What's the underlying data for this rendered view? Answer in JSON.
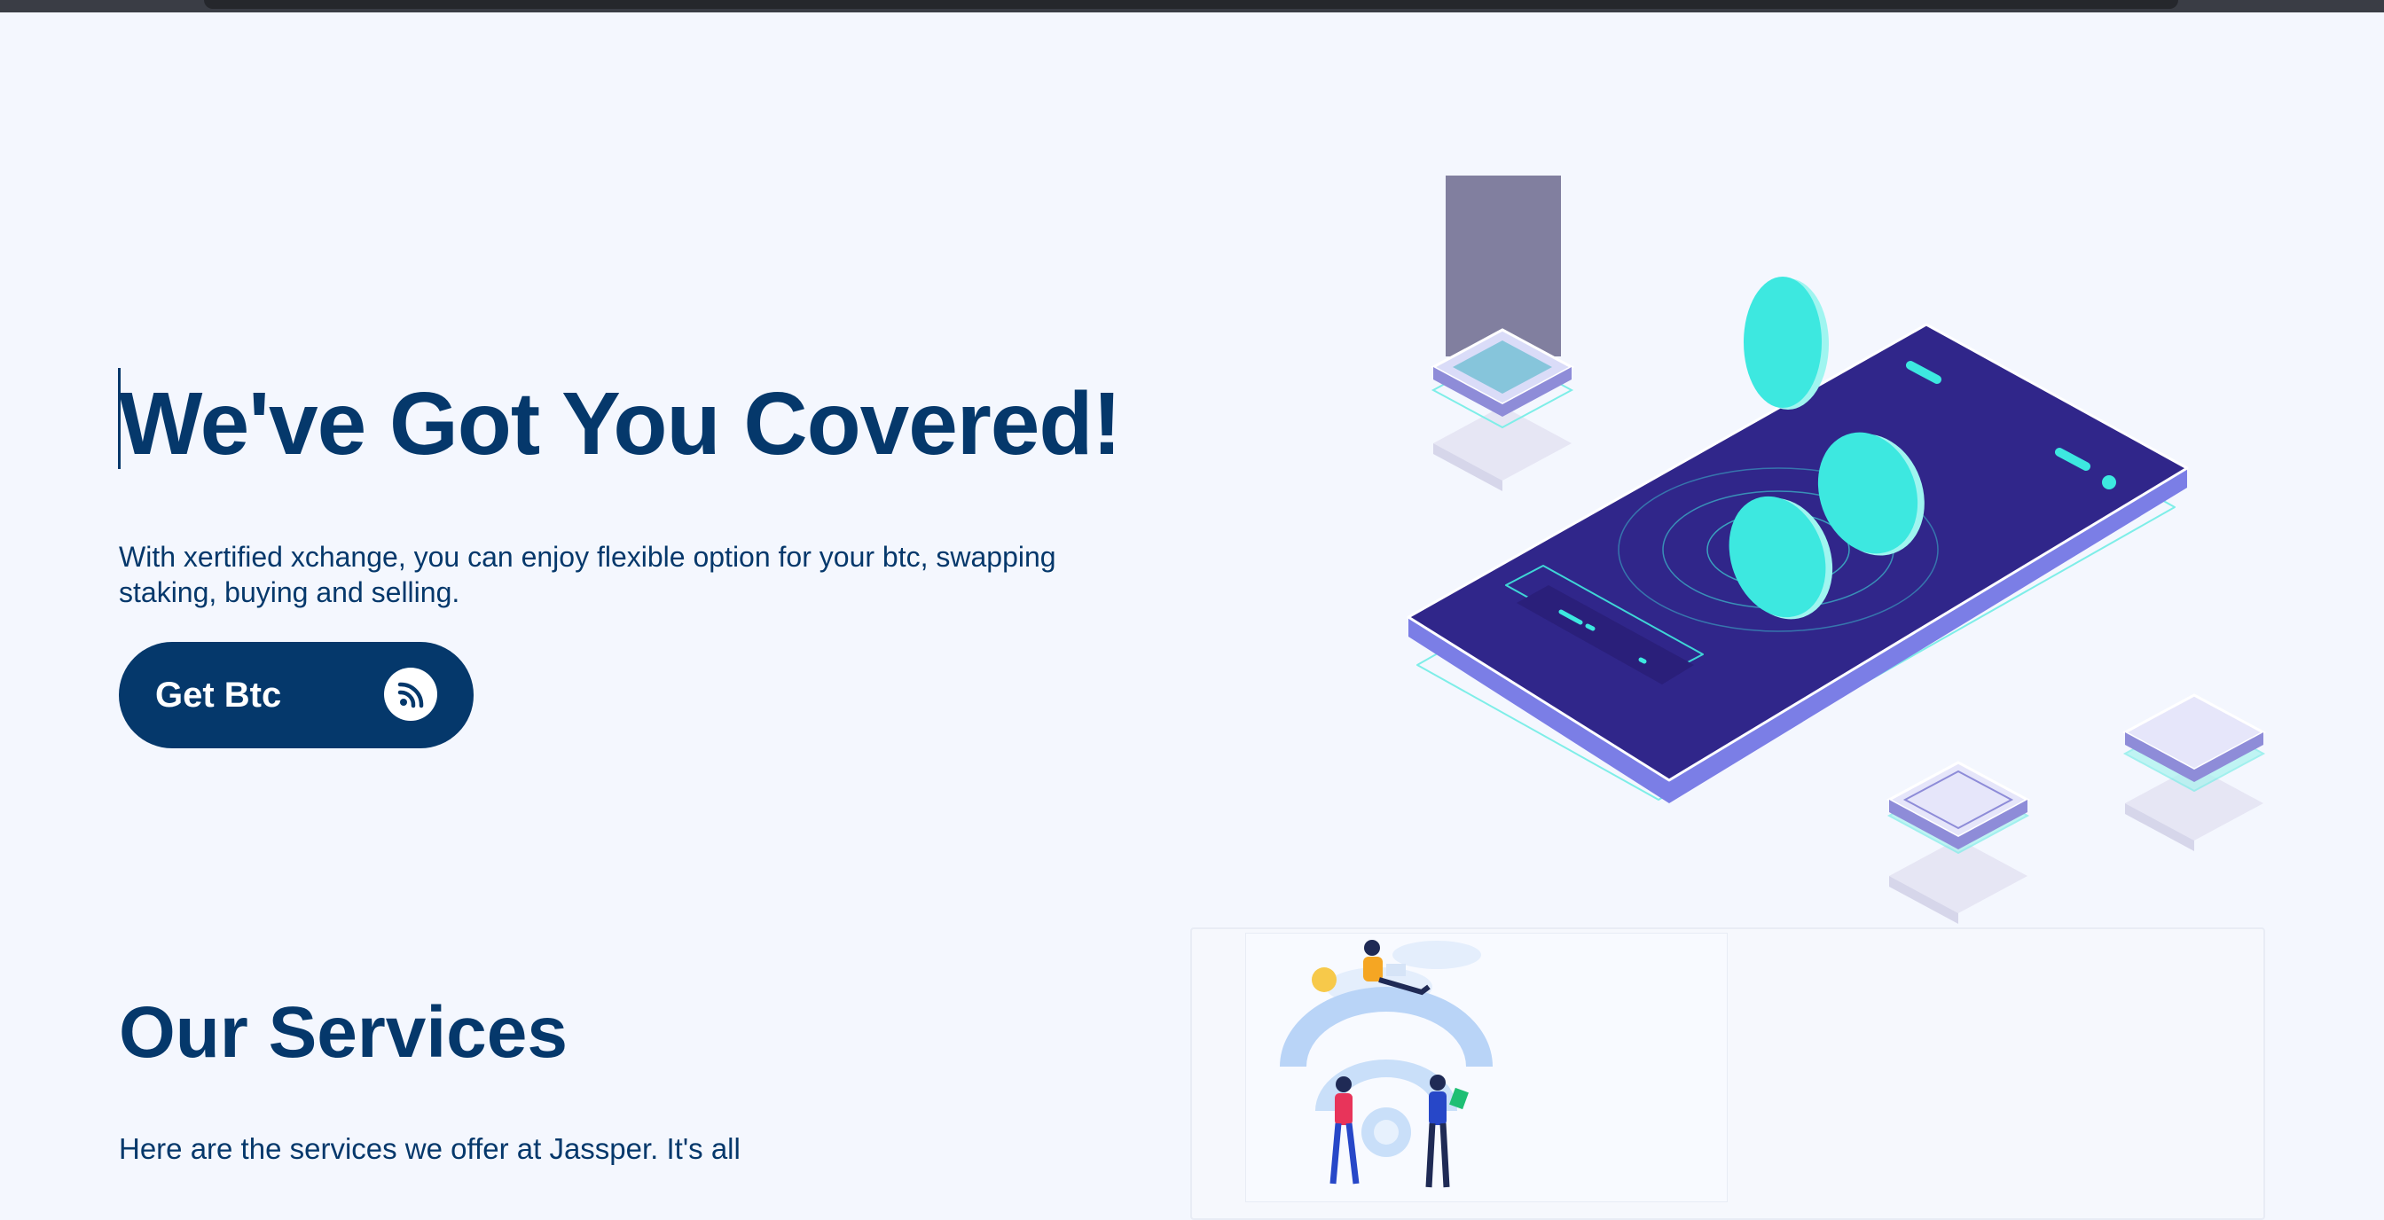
{
  "hero": {
    "title": "We've Got You Covered!",
    "subtitle": "With xertified xchange, you can enjoy flexible option for your btc, swapping staking, buying and selling.",
    "cta_label": "Get Btc",
    "cta_icon": "rss-icon"
  },
  "services": {
    "title": "Our Services",
    "text": "Here are the services we offer at Jassper. It's all"
  },
  "colors": {
    "background": "#f4f7fe",
    "primary": "#05386b",
    "accent_cyan": "#3de8e0",
    "phone": "#30268a",
    "phone_edge": "#6f6ce0"
  }
}
